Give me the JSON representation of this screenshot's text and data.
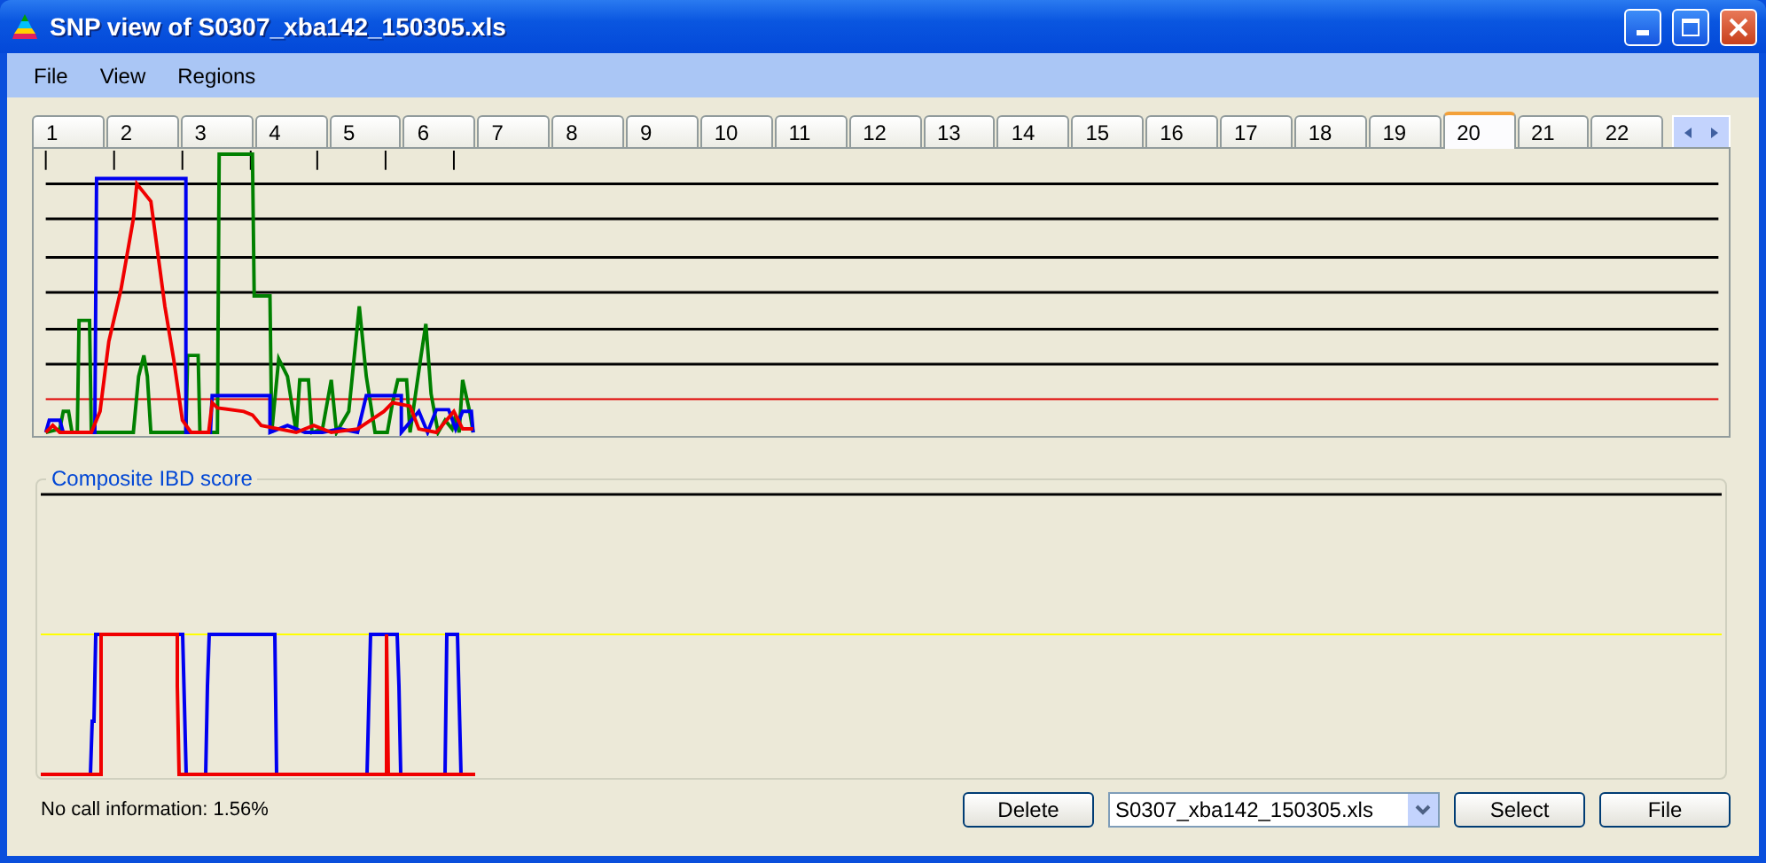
{
  "window": {
    "title": "SNP view of S0307_xba142_150305.xls"
  },
  "menu": [
    "File",
    "View",
    "Regions"
  ],
  "tabs": [
    {
      "label": "1",
      "selected": false
    },
    {
      "label": "2",
      "selected": false
    },
    {
      "label": "3",
      "selected": false
    },
    {
      "label": "4",
      "selected": false
    },
    {
      "label": "5",
      "selected": false
    },
    {
      "label": "6",
      "selected": false
    },
    {
      "label": "7",
      "selected": false
    },
    {
      "label": "8",
      "selected": false
    },
    {
      "label": "9",
      "selected": false
    },
    {
      "label": "10",
      "selected": false
    },
    {
      "label": "11",
      "selected": false
    },
    {
      "label": "12",
      "selected": false
    },
    {
      "label": "13",
      "selected": false
    },
    {
      "label": "14",
      "selected": false
    },
    {
      "label": "15",
      "selected": false
    },
    {
      "label": "16",
      "selected": false
    },
    {
      "label": "17",
      "selected": false
    },
    {
      "label": "18",
      "selected": false
    },
    {
      "label": "19",
      "selected": false
    },
    {
      "label": "20",
      "selected": true
    },
    {
      "label": "21",
      "selected": false
    },
    {
      "label": "22",
      "selected": false
    }
  ],
  "composite_panel": {
    "title": "Composite IBD score"
  },
  "status": "No call information: 1.56%",
  "delete_button": "Delete",
  "file_select": {
    "value": "S0307_xba142_150305.xls"
  },
  "select_button": "Select",
  "file_button": "File"
}
